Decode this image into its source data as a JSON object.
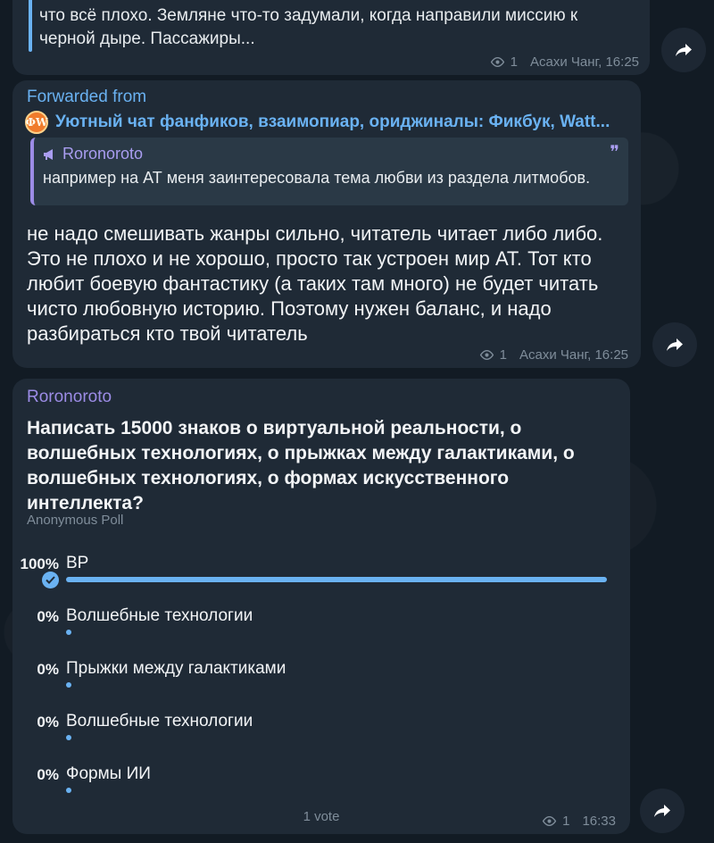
{
  "messages": [
    {
      "text": "что всё плохо. Земляне что-то задумали, когда направили миссию к черной дыре. Пассажиры...",
      "views": "1",
      "author_time": "Асахи Чанг, 16:25"
    },
    {
      "forwarded_label": "Forwarded from",
      "forwarded_avatar": "ФW",
      "forwarded_name": "Уютный чат фанфиков, взаимопиар, ориджиналы: Фикбук, Watt...",
      "reply": {
        "author": "Roronoroto",
        "text": "например на АТ меня заинтересовала тема любви из раздела литмобов."
      },
      "text": "не надо смешивать жанры сильно, читатель читает либо либо. Это не плохо и не хорошо, просто так устроен мир АТ. Тот кто любит боевую фантастику (а таких там много) не будет читать чисто любовную историю. Поэтому нужен баланс, и надо разбираться кто твой читатель",
      "views": "1",
      "author_time": "Асахи Чанг, 16:25"
    },
    {
      "author": "Roronoroto",
      "poll": {
        "question": "Написать 15000 знаков о виртуальной реальности, о волшебных технологиях, о прыжках между галактиками, о волшебных технологиях, о формах искусственного интеллекта?",
        "type": "Anonymous Poll",
        "options": [
          {
            "percent": "100%",
            "label": "ВР",
            "fraction": 1.0,
            "selected": true
          },
          {
            "percent": "0%",
            "label": "Волшебные технологии",
            "fraction": 0.0,
            "selected": false
          },
          {
            "percent": "0%",
            "label": "Прыжки между галактиками",
            "fraction": 0.0,
            "selected": false
          },
          {
            "percent": "0%",
            "label": "Волшебные технологии",
            "fraction": 0.0,
            "selected": false
          },
          {
            "percent": "0%",
            "label": "Формы ИИ",
            "fraction": 0.0,
            "selected": false
          }
        ],
        "votes": "1 vote"
      },
      "views": "1",
      "time": "16:33"
    }
  ],
  "colors": {
    "accent": "#6ab2f2",
    "author": "#9c8ce6",
    "bubble": "#1f2a36",
    "background": "#121b24"
  }
}
